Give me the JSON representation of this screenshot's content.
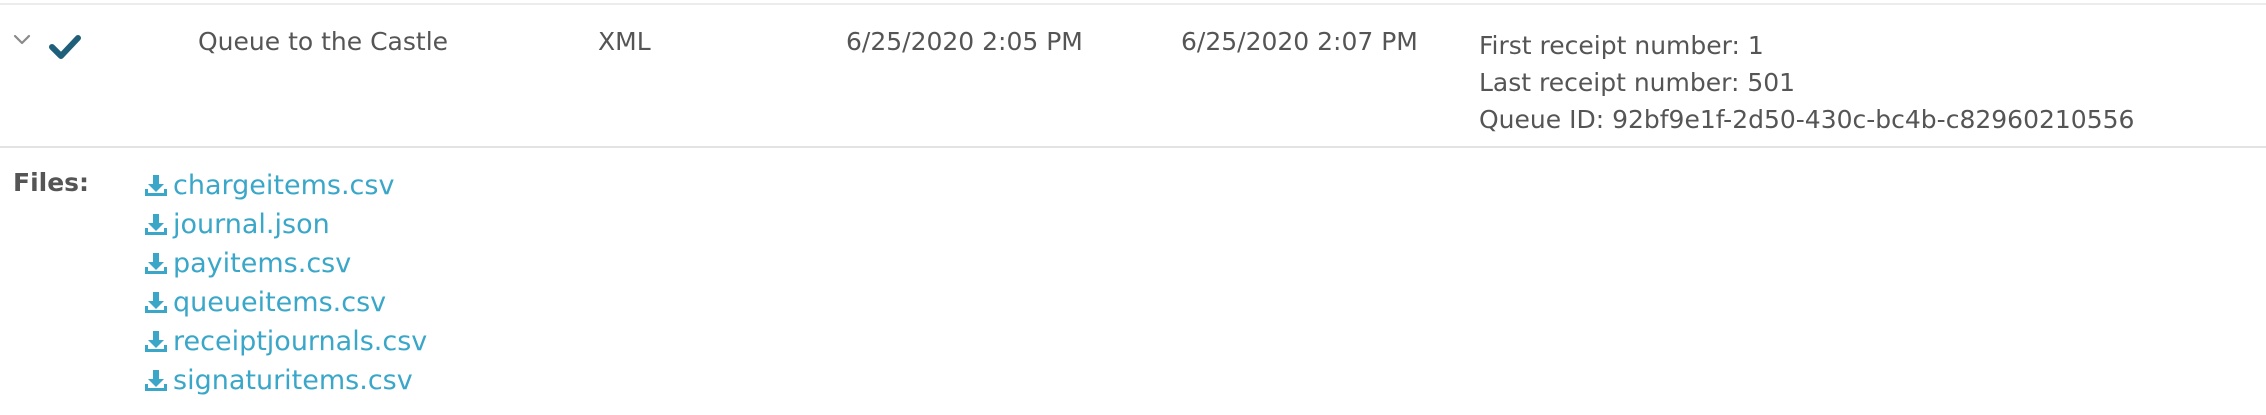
{
  "row": {
    "name": "Queue to the Castle",
    "format": "XML",
    "start_time": "6/25/2020 2:05 PM",
    "end_time": "6/25/2020 2:07 PM",
    "details": [
      "First receipt number: 1",
      "Last receipt number: 501",
      "Queue ID: 92bf9e1f-2d50-430c-bc4b-c82960210556"
    ],
    "status_icon": "check-icon",
    "expand_icon": "chevron-down-icon"
  },
  "files": {
    "label": "Files:",
    "icon": "download-icon",
    "items": [
      "chargeitems.csv",
      "journal.json",
      "payitems.csv",
      "queueitems.csv",
      "receiptjournals.csv",
      "signaturitems.csv"
    ]
  },
  "colors": {
    "link": "#3aa7c9",
    "check": "#1f5f7a",
    "text": "#555555"
  }
}
